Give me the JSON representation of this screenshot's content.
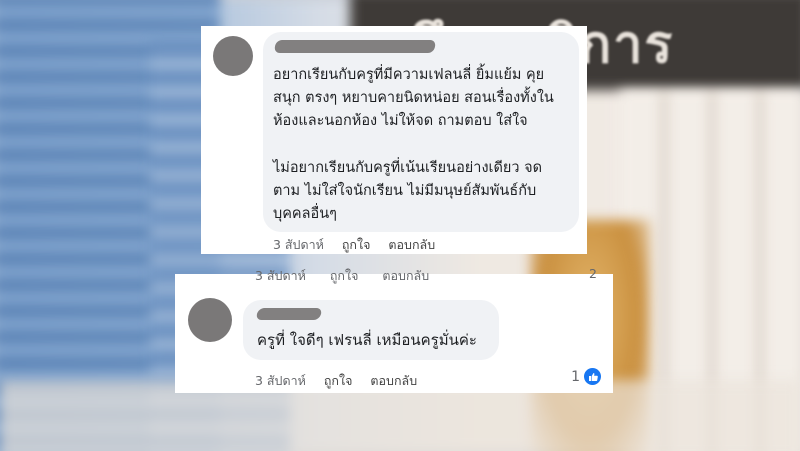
{
  "background": {
    "sign_text": "ศึกษาธิการ"
  },
  "comment1": {
    "paragraph1": [
      "อยากเรียนกับครูที่มีความเฟลนลี่ ยิ้มแย้ม คุย",
      "สนุก ตรงๆ หยาบคายนิดหน่อย สอนเรื่องทั้งใน",
      "ห้องและนอกห้อง  ไม่ให้จด ถามตอบ ใส่ใจ"
    ],
    "paragraph2": [
      "ไม่อยากเรียนกับครูที่เน้นเรียนอย่างเดียว  จด",
      "ตาม  ไม่ใส่ใจนักเรียน ไม่มีมนุษย์สัมพันธ์กับ",
      "บุคคลอื่นๆ"
    ],
    "time": "3 สัปดาห์",
    "like_label": "ถูกใจ",
    "reply_label": "ตอบกลับ"
  },
  "clipped_row": {
    "time": "3 สัปดาห์",
    "like_label": "ถูกใจ",
    "reply_label": "ตอบกลับ",
    "count": "2"
  },
  "comment2": {
    "text": "ครูที่ ใจดีๆ เฟรนลี่ เหมือนครูมั่นค่ะ",
    "time": "3 สัปดาห์",
    "like_label": "ถูกใจ",
    "reply_label": "ตอบกลับ",
    "reaction_count": "1",
    "reaction_icon": "thumbs-up-icon",
    "accent_color": "#1877f2"
  }
}
